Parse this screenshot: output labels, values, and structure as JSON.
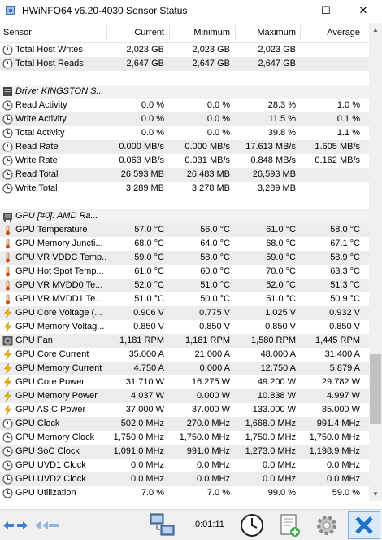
{
  "window": {
    "title": "HWiNFO64 v6.20-4030 Sensor Status",
    "min": "—",
    "max": "☐",
    "close": "✕"
  },
  "columns": {
    "sensor": "Sensor",
    "current": "Current",
    "minimum": "Minimum",
    "maximum": "Maximum",
    "average": "Average"
  },
  "rows": [
    {
      "type": "data",
      "icon": "clock",
      "name": "Total Host Writes",
      "cur": "2,023 GB",
      "min": "2,023 GB",
      "max": "2,023 GB",
      "avg": ""
    },
    {
      "type": "data",
      "icon": "clock",
      "name": "Total Host Reads",
      "cur": "2,647 GB",
      "min": "2,647 GB",
      "max": "2,647 GB",
      "avg": ""
    },
    {
      "type": "blank"
    },
    {
      "type": "group",
      "icon": "drive",
      "name": "Drive: KINGSTON S..."
    },
    {
      "type": "data",
      "icon": "clock",
      "name": "Read Activity",
      "cur": "0.0 %",
      "min": "0.0 %",
      "max": "28.3 %",
      "avg": "1.0 %"
    },
    {
      "type": "data",
      "icon": "clock",
      "name": "Write Activity",
      "cur": "0.0 %",
      "min": "0.0 %",
      "max": "11.5 %",
      "avg": "0.1 %"
    },
    {
      "type": "data",
      "icon": "clock",
      "name": "Total Activity",
      "cur": "0.0 %",
      "min": "0.0 %",
      "max": "39.8 %",
      "avg": "1.1 %"
    },
    {
      "type": "data",
      "icon": "clock",
      "name": "Read Rate",
      "cur": "0.000 MB/s",
      "min": "0.000 MB/s",
      "max": "17.613 MB/s",
      "avg": "1.605 MB/s"
    },
    {
      "type": "data",
      "icon": "clock",
      "name": "Write Rate",
      "cur": "0.063 MB/s",
      "min": "0.031 MB/s",
      "max": "0.848 MB/s",
      "avg": "0.162 MB/s"
    },
    {
      "type": "data",
      "icon": "clock",
      "name": "Read Total",
      "cur": "26,593 MB",
      "min": "26,483 MB",
      "max": "26,593 MB",
      "avg": ""
    },
    {
      "type": "data",
      "icon": "clock",
      "name": "Write Total",
      "cur": "3,289 MB",
      "min": "3,278 MB",
      "max": "3,289 MB",
      "avg": ""
    },
    {
      "type": "blank"
    },
    {
      "type": "group",
      "icon": "gpu",
      "name": "GPU [#0]: AMD Ra..."
    },
    {
      "type": "data",
      "icon": "thermo",
      "name": "GPU Temperature",
      "cur": "57.0 °C",
      "min": "56.0 °C",
      "max": "61.0 °C",
      "avg": "58.0 °C"
    },
    {
      "type": "data",
      "icon": "thermo",
      "name": "GPU Memory Juncti...",
      "cur": "68.0 °C",
      "min": "64.0 °C",
      "max": "68.0 °C",
      "avg": "67.1 °C"
    },
    {
      "type": "data",
      "icon": "thermo",
      "name": "GPU VR VDDC Temp...",
      "cur": "59.0 °C",
      "min": "58.0 °C",
      "max": "59.0 °C",
      "avg": "58.9 °C"
    },
    {
      "type": "data",
      "icon": "thermo",
      "name": "GPU Hot Spot Temp...",
      "cur": "61.0 °C",
      "min": "60.0 °C",
      "max": "70.0 °C",
      "avg": "63.3 °C"
    },
    {
      "type": "data",
      "icon": "thermo",
      "name": "GPU VR MVDD0 Te...",
      "cur": "52.0 °C",
      "min": "51.0 °C",
      "max": "52.0 °C",
      "avg": "51.3 °C"
    },
    {
      "type": "data",
      "icon": "thermo",
      "name": "GPU VR MVDD1 Te...",
      "cur": "51.0 °C",
      "min": "50.0 °C",
      "max": "51.0 °C",
      "avg": "50.9 °C"
    },
    {
      "type": "data",
      "icon": "bolt",
      "name": "GPU Core Voltage (...",
      "cur": "0.906 V",
      "min": "0.775 V",
      "max": "1.025 V",
      "avg": "0.932 V"
    },
    {
      "type": "data",
      "icon": "bolt",
      "name": "GPU Memory Voltag...",
      "cur": "0.850 V",
      "min": "0.850 V",
      "max": "0.850 V",
      "avg": "0.850 V"
    },
    {
      "type": "data",
      "icon": "fan",
      "name": "GPU Fan",
      "cur": "1,181 RPM",
      "min": "1,181 RPM",
      "max": "1,580 RPM",
      "avg": "1,445 RPM"
    },
    {
      "type": "data",
      "icon": "bolt",
      "name": "GPU Core Current",
      "cur": "35.000 A",
      "min": "21.000 A",
      "max": "48.000 A",
      "avg": "31.400 A"
    },
    {
      "type": "data",
      "icon": "bolt",
      "name": "GPU Memory Current",
      "cur": "4.750 A",
      "min": "0.000 A",
      "max": "12.750 A",
      "avg": "5.879 A"
    },
    {
      "type": "data",
      "icon": "bolt",
      "name": "GPU Core Power",
      "cur": "31.710 W",
      "min": "16.275 W",
      "max": "49.200 W",
      "avg": "29.782 W"
    },
    {
      "type": "data",
      "icon": "bolt",
      "name": "GPU Memory Power",
      "cur": "4.037 W",
      "min": "0.000 W",
      "max": "10.838 W",
      "avg": "4.997 W"
    },
    {
      "type": "data",
      "icon": "bolt",
      "name": "GPU ASIC Power",
      "cur": "37.000 W",
      "min": "37.000 W",
      "max": "133.000 W",
      "avg": "85.000 W"
    },
    {
      "type": "data",
      "icon": "clock",
      "name": "GPU Clock",
      "cur": "502.0 MHz",
      "min": "270.0 MHz",
      "max": "1,668.0 MHz",
      "avg": "991.4 MHz"
    },
    {
      "type": "data",
      "icon": "clock",
      "name": "GPU Memory Clock",
      "cur": "1,750.0 MHz",
      "min": "1,750.0 MHz",
      "max": "1,750.0 MHz",
      "avg": "1,750.0 MHz"
    },
    {
      "type": "data",
      "icon": "clock",
      "name": "GPU SoC Clock",
      "cur": "1,091.0 MHz",
      "min": "991.0 MHz",
      "max": "1,273.0 MHz",
      "avg": "1,198.9 MHz"
    },
    {
      "type": "data",
      "icon": "clock",
      "name": "GPU UVD1 Clock",
      "cur": "0.0 MHz",
      "min": "0.0 MHz",
      "max": "0.0 MHz",
      "avg": "0.0 MHz"
    },
    {
      "type": "data",
      "icon": "clock",
      "name": "GPU UVD2 Clock",
      "cur": "0.0 MHz",
      "min": "0.0 MHz",
      "max": "0.0 MHz",
      "avg": "0.0 MHz"
    },
    {
      "type": "data",
      "icon": "clock",
      "name": "GPU Utilization",
      "cur": "7.0 %",
      "min": "7.0 %",
      "max": "99.0 %",
      "avg": "59.0 %"
    }
  ],
  "toolbar": {
    "timer": "0:01:11"
  },
  "colors": {
    "accent": "#0078d7",
    "thermo": "#d08a2a",
    "bolt": "#f2b600"
  }
}
